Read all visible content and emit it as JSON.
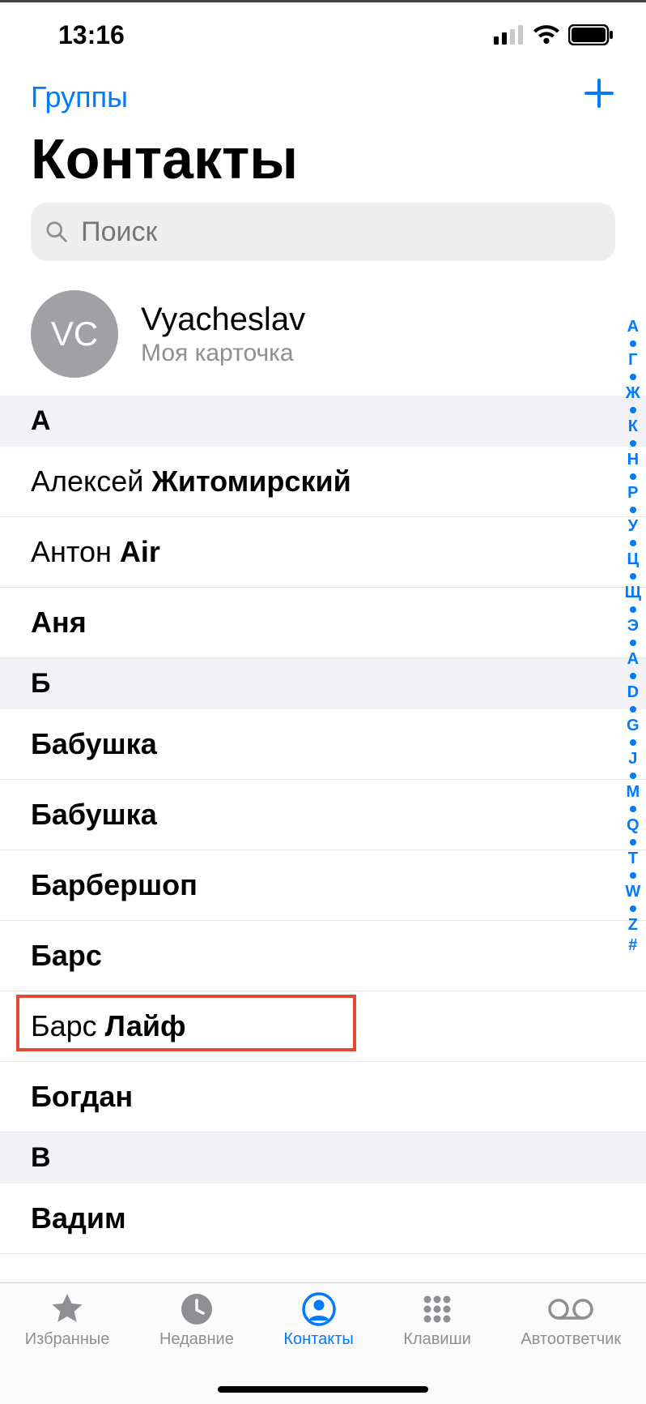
{
  "status": {
    "time": "13:16"
  },
  "nav": {
    "groups": "Группы"
  },
  "title": "Контакты",
  "search": {
    "placeholder": "Поиск"
  },
  "myCard": {
    "initials": "VC",
    "name": "Vyacheslav",
    "sub": "Моя карточка"
  },
  "sections": [
    {
      "letter": "А",
      "rows": [
        {
          "first": "Алексей ",
          "last": "Житомирский"
        },
        {
          "first": "Антон ",
          "last": "Air"
        },
        {
          "first": "",
          "last": "Аня"
        }
      ]
    },
    {
      "letter": "Б",
      "rows": [
        {
          "first": "",
          "last": "Бабушка"
        },
        {
          "first": "",
          "last": "Бабушка"
        },
        {
          "first": "",
          "last": "Барбершоп"
        },
        {
          "first": "",
          "last": "Барс"
        },
        {
          "first": "Барс ",
          "last": "Лайф",
          "highlighted": true
        },
        {
          "first": "",
          "last": "Богдан"
        }
      ]
    },
    {
      "letter": "В",
      "rows": [
        {
          "first": "",
          "last": "Вадим"
        }
      ]
    }
  ],
  "index": [
    "А",
    "•",
    "Г",
    "•",
    "Ж",
    "•",
    "К",
    "•",
    "Н",
    "•",
    "Р",
    "•",
    "У",
    "•",
    "Ц",
    "•",
    "Щ",
    "•",
    "Э",
    "•",
    "A",
    "•",
    "D",
    "•",
    "G",
    "•",
    "J",
    "•",
    "M",
    "•",
    "Q",
    "•",
    "T",
    "•",
    "W",
    "•",
    "Z",
    "#"
  ],
  "tabs": {
    "fav": "Избранные",
    "rec": "Недавние",
    "con": "Контакты",
    "key": "Клавиши",
    "vm": "Автоответчик"
  }
}
